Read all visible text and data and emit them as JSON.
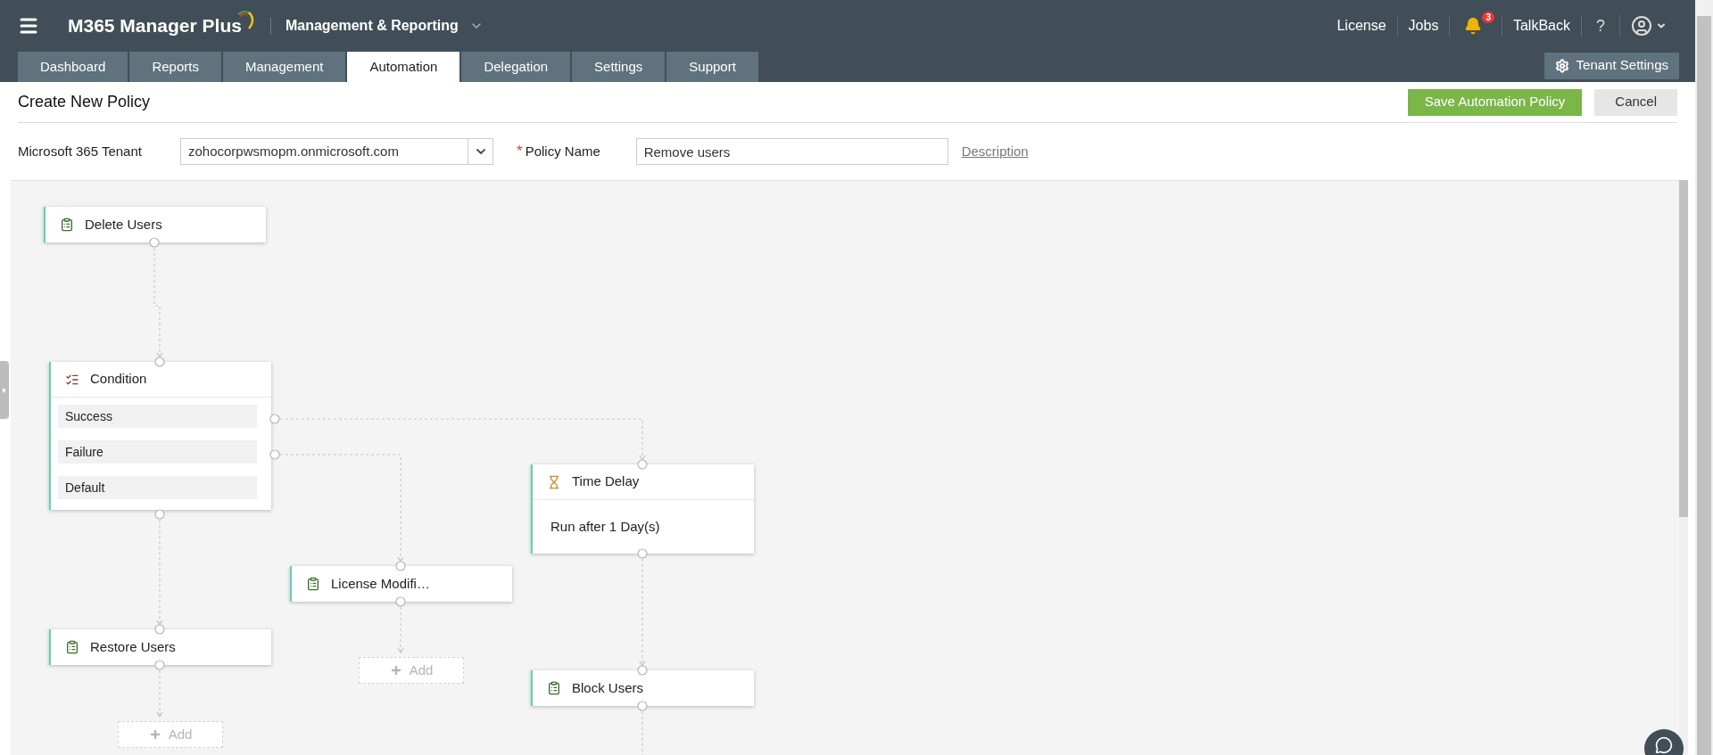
{
  "header": {
    "product": "M365 Manager Plus",
    "module": "Management & Reporting",
    "links": [
      "License",
      "Jobs"
    ],
    "notification_count": "3",
    "talkback": "TalkBack",
    "help": "?"
  },
  "tabs": [
    {
      "label": "Dashboard",
      "selected": false
    },
    {
      "label": "Reports",
      "selected": false
    },
    {
      "label": "Management",
      "selected": false
    },
    {
      "label": "Automation",
      "selected": true
    },
    {
      "label": "Delegation",
      "selected": false
    },
    {
      "label": "Settings",
      "selected": false
    },
    {
      "label": "Support",
      "selected": false
    }
  ],
  "tenant_settings": "Tenant Settings",
  "page": {
    "title": "Create New Policy",
    "save": "Save Automation Policy",
    "cancel": "Cancel"
  },
  "form": {
    "tenant_label": "Microsoft 365 Tenant",
    "tenant_value": "zohocorpwsmopm.onmicrosoft.com",
    "required_mark": "*",
    "policy_label": "Policy Name",
    "policy_value": "Remove users",
    "description_link": "Description"
  },
  "nodes": [
    {
      "kind": "action",
      "label": "Delete Users"
    },
    {
      "kind": "condition",
      "label": "Condition",
      "branches": [
        "Success",
        "Failure",
        "Default"
      ]
    },
    {
      "kind": "delay",
      "label": "Time Delay",
      "detail": "Run after 1 Day(s)"
    },
    {
      "kind": "action",
      "label": "License Modifi…"
    },
    {
      "kind": "add",
      "label": "Add"
    },
    {
      "kind": "action",
      "label": "Restore Users"
    },
    {
      "kind": "action",
      "label": "Block Users"
    },
    {
      "kind": "add",
      "label": "Add"
    }
  ]
}
